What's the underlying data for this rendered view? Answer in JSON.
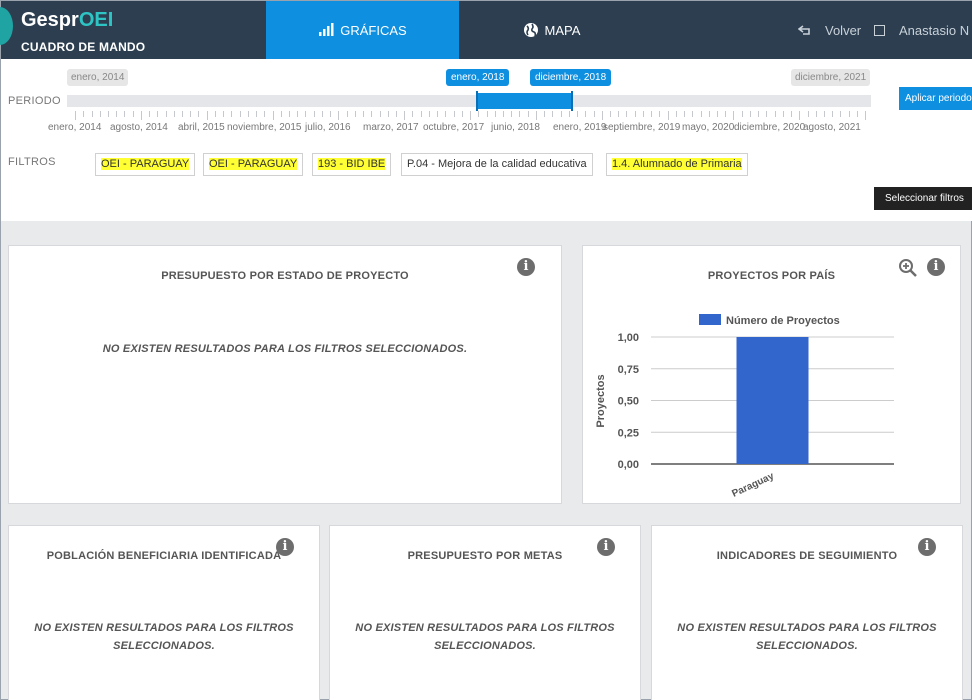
{
  "header": {
    "logo_prefix": "Gespr",
    "logo_accent": "OEI",
    "logo_subtitle": "CUADRO DE MANDO",
    "tabs": [
      {
        "label": "GRÁFICAS",
        "icon": "bar-chart-icon",
        "active": true
      },
      {
        "label": "MAPA",
        "icon": "globe-icon",
        "active": false
      }
    ],
    "back_label": "Volver",
    "user_name": "Anastasio N"
  },
  "periodo": {
    "label": "PERIODO",
    "range_start": "enero, 2014",
    "range_end": "diciembre, 2021",
    "selected_start": "enero, 2018",
    "selected_end": "diciembre, 2018",
    "apply_label": "Aplicar periodo",
    "tick_labels": [
      "enero, 2014",
      "agosto, 2014",
      "abril, 2015",
      "noviembre, 2015",
      "julio, 2016",
      "marzo, 2017",
      "octubre, 2017",
      "junio, 2018",
      "enero, 2019",
      "septiembre, 2019",
      "mayo, 2020",
      "diciembre, 2020",
      "agosto, 2021"
    ]
  },
  "filtros": {
    "label": "FILTROS",
    "chips": [
      {
        "label": "OEI - PARAGUAY"
      },
      {
        "label": "OEI - PARAGUAY"
      },
      {
        "label": "193 - BID IBE"
      },
      {
        "label": "P.04 - Mejora de la calidad educativa"
      },
      {
        "label": "1.4. Alumnado de Primaria"
      }
    ],
    "select_label": "Seleccionar filtros"
  },
  "cards": {
    "presupuesto_estado": {
      "title": "PRESUPUESTO POR ESTADO DE PROYECTO",
      "message": "NO EXISTEN RESULTADOS PARA LOS FILTROS SELECCIONADOS."
    },
    "proyectos_pais": {
      "title": "PROYECTOS POR PAÍS"
    },
    "poblacion": {
      "title": "POBLACIÓN BENEFICIARIA IDENTIFICADA",
      "message_line1": "NO EXISTEN RESULTADOS PARA LOS FILTROS",
      "message_line2": "SELECCIONADOS."
    },
    "presupuesto_metas": {
      "title": "PRESUPUESTO POR METAS",
      "message_line1": "NO EXISTEN RESULTADOS PARA LOS FILTROS",
      "message_line2": "SELECCIONADOS."
    },
    "indicadores": {
      "title": "INDICADORES DE SEGUIMIENTO",
      "message_line1": "NO EXISTEN RESULTADOS PARA LOS FILTROS",
      "message_line2": "SELECCIONADOS."
    }
  },
  "chart_data": {
    "type": "bar",
    "title": "PROYECTOS POR PAÍS",
    "categories": [
      "Paraguay"
    ],
    "series": [
      {
        "name": "Número de Proyectos",
        "values": [
          1
        ],
        "color": "#3366cc"
      }
    ],
    "xlabel": "",
    "ylabel": "Proyectos",
    "ylim": [
      0,
      1
    ],
    "yticks": [
      "0,00",
      "0,25",
      "0,50",
      "0,75",
      "1,00"
    ],
    "grid": true,
    "legend": "top"
  }
}
